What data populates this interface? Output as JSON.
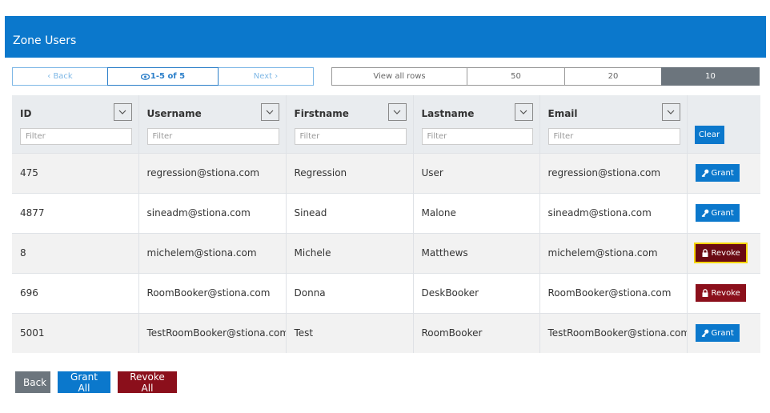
{
  "header": {
    "title": "Zone Users"
  },
  "pager": {
    "back_label": "‹ Back",
    "info_label": "1-5 of 5",
    "next_label": "Next ›"
  },
  "rows_per_page": {
    "options": [
      "View all rows",
      "50",
      "20",
      "10"
    ],
    "selected": "10"
  },
  "table": {
    "columns": [
      {
        "label": "ID",
        "filter_placeholder": "Filter"
      },
      {
        "label": "Username",
        "filter_placeholder": "Filter"
      },
      {
        "label": "Firstname",
        "filter_placeholder": "Filter"
      },
      {
        "label": "Lastname",
        "filter_placeholder": "Filter"
      },
      {
        "label": "Email",
        "filter_placeholder": "Filter"
      }
    ],
    "clear_label": "Clear",
    "rows": [
      {
        "id": "475",
        "username": "regression@stiona.com",
        "firstname": "Regression",
        "lastname": "User",
        "email": "regression@stiona.com",
        "action": "Grant"
      },
      {
        "id": "4877",
        "username": "sineadm@stiona.com",
        "firstname": "Sinead",
        "lastname": "Malone",
        "email": "sineadm@stiona.com",
        "action": "Grant"
      },
      {
        "id": "8",
        "username": "michelem@stiona.com",
        "firstname": "Michele",
        "lastname": "Matthews",
        "email": "michelem@stiona.com",
        "action": "Revoke"
      },
      {
        "id": "696",
        "username": "RoomBooker@stiona.com",
        "firstname": "Donna",
        "lastname": "DeskBooker",
        "email": "RoomBooker@stiona.com",
        "action": "Revoke"
      },
      {
        "id": "5001",
        "username": "TestRoomBooker@stiona.com",
        "firstname": "Test",
        "lastname": "RoomBooker",
        "email": "TestRoomBooker@stiona.com",
        "action": "Grant"
      }
    ]
  },
  "footer": {
    "back_label": "Back",
    "grant_all_label": "Grant All",
    "revoke_all_label": "Revoke All"
  },
  "colors": {
    "primary": "#0b78cc",
    "danger": "#8b0f1b",
    "secondary": "#6c757d",
    "focus": "#f5d50a"
  }
}
